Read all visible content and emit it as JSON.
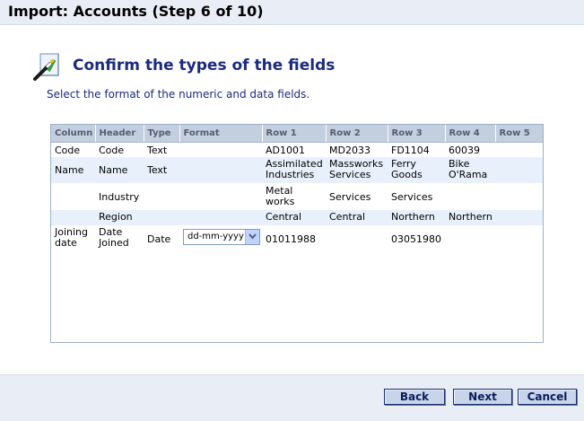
{
  "window": {
    "title": "Import: Accounts (Step 6 of 10)"
  },
  "page": {
    "heading": "Confirm the types of the fields",
    "subtitle": "Select the format of the numeric and data fields.",
    "icon": "wizard-wand-icon"
  },
  "grid": {
    "columns": [
      "Column",
      "Header",
      "Type",
      "Format",
      "Row 1",
      "Row 2",
      "Row 3",
      "Row 4",
      "Row 5"
    ],
    "rows": [
      {
        "column": "Code",
        "header": "Code",
        "type": "Text",
        "format": "",
        "row1": "AD1001",
        "row2": "MD2033",
        "row3": "FD1104",
        "row4": "60039",
        "row5": ""
      },
      {
        "column": "Name",
        "header": "Name",
        "type": "Text",
        "format": "",
        "row1": "Assimilated Industries",
        "row2": "Massworks Services",
        "row3": "Ferry Goods",
        "row4": "Bike O'Rama",
        "row5": ""
      },
      {
        "column": "",
        "header": "Industry",
        "type": "",
        "format": "",
        "row1": "Metal works",
        "row2": "Services",
        "row3": "Services",
        "row4": "",
        "row5": ""
      },
      {
        "column": "",
        "header": "Region",
        "type": "",
        "format": "",
        "row1": "Central",
        "row2": "Central",
        "row3": "Northern",
        "row4": "Northern",
        "row5": ""
      },
      {
        "column": "Joining date",
        "header": "Date Joined",
        "type": "Date",
        "format": "dd-mm-yyyy",
        "row1": "01011988",
        "row2": "",
        "row3": "03051980",
        "row4": "",
        "row5": ""
      }
    ]
  },
  "buttons": {
    "back": "Back",
    "next": "Next",
    "cancel": "Cancel"
  }
}
